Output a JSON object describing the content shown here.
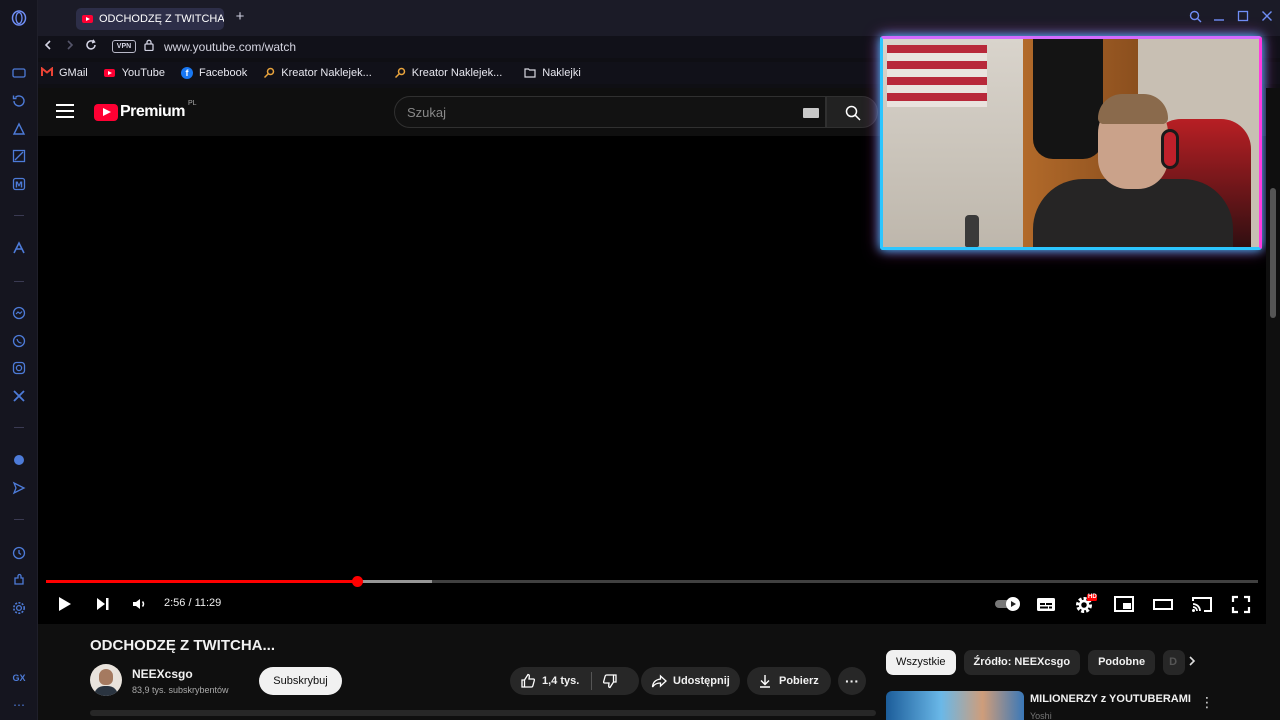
{
  "browser": {
    "tab_title": "ODCHODZĘ Z TWITCHA...",
    "new_tab": "+",
    "url": "www.youtube.com/watch",
    "vpn_label": "VPN",
    "sidebar_label": "GX",
    "icons": [
      "opera-logo-icon",
      "back-icon",
      "forward-icon",
      "reload-icon",
      "lock-icon",
      "search-icon",
      "minimize-icon",
      "maximize-icon",
      "close-icon"
    ]
  },
  "bookmarks": [
    {
      "label": "GMail",
      "icon": "gmail-icon",
      "color": "#ea4335"
    },
    {
      "label": "YouTube",
      "icon": "youtube-icon",
      "color": "#ff0033"
    },
    {
      "label": "Facebook",
      "icon": "facebook-icon",
      "color": "#1877f2"
    },
    {
      "label": "Kreator Naklejek...",
      "icon": "key-icon",
      "color": "#e8a33c"
    },
    {
      "label": "Kreator Naklejek...",
      "icon": "key-icon",
      "color": "#e8a33c"
    },
    {
      "label": "Naklejki",
      "icon": "folder-icon",
      "color": "#d8d8e0"
    }
  ],
  "youtube": {
    "logo_text": "Premium",
    "logo_country": "PL",
    "search_placeholder": "Szukaj"
  },
  "player": {
    "time": "2:56 / 11:29",
    "played_fraction": 0.257,
    "buffered_fraction": 0.3186,
    "hd_badge": "HD"
  },
  "video": {
    "title": "ODCHODZĘ Z TWITCHA...",
    "channel": "NEEXcsgo",
    "subscribers": "83,9 tys. subskrybentów",
    "subscribe_label": "Subskrybuj",
    "likes": "1,4 tys.",
    "share_label": "Udostępnij",
    "download_label": "Pobierz",
    "more": "···"
  },
  "chips": [
    {
      "label": "Wszystkie",
      "active": true
    },
    {
      "label": "Źródło: NEEXcsgo",
      "active": false
    },
    {
      "label": "Podobne",
      "active": false
    },
    {
      "label": "D",
      "active": false
    }
  ],
  "recommendation": {
    "title": "MILIONERZY z YOUTUBERAMI",
    "channel": "Yoshi"
  },
  "colors": {
    "accent_red": "#ff0000",
    "opera_blue": "#4d7bd8",
    "webcam_cyan": "#2cc6ff",
    "webcam_pink": "#ff3ae0"
  }
}
